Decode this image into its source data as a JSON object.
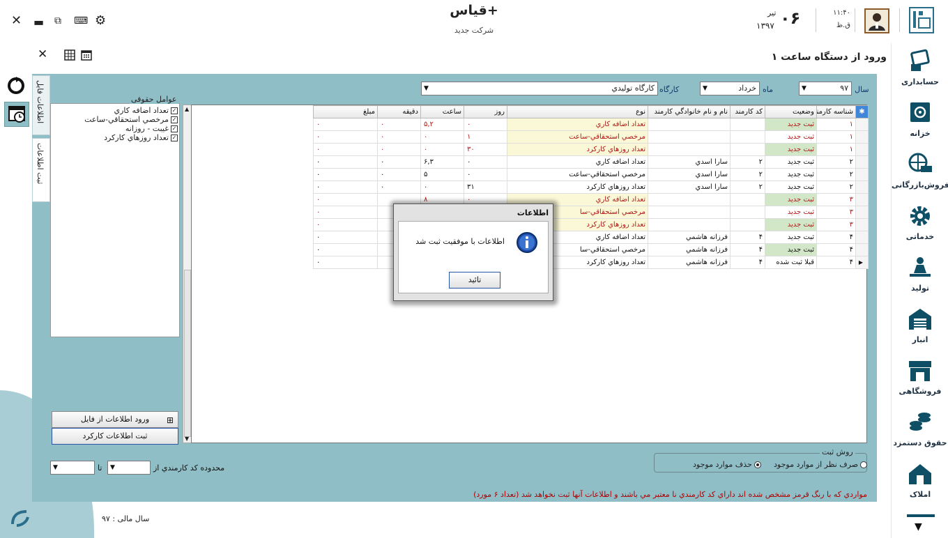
{
  "app": {
    "title": "قیاس+",
    "company": "شرکت جدید"
  },
  "clock": {
    "time": "۱۱:۴۰",
    "ampm": "ق.ظ",
    "day": "۰۶",
    "month": "تیر",
    "year": "۱۳۹۷"
  },
  "sidebar": {
    "items": [
      {
        "label": "حسابداری",
        "icon": "accounting-icon"
      },
      {
        "label": "خزانه",
        "icon": "safe-icon"
      },
      {
        "label": "فروش‌بازرگانی",
        "icon": "globe-truck-icon"
      },
      {
        "label": "خدماتی",
        "icon": "gear-icon"
      },
      {
        "label": "تولید",
        "icon": "worker-icon"
      },
      {
        "label": "انبار",
        "icon": "warehouse-icon"
      },
      {
        "label": "فروشگاهی",
        "icon": "store-icon"
      },
      {
        "label": "حقوق دستمزد",
        "icon": "coins-icon"
      },
      {
        "label": "املاک",
        "icon": "house-icon"
      }
    ]
  },
  "form": {
    "title": "ورود از دستگاه ساعت ۱"
  },
  "tabs": {
    "file": "اطلاعات فایل",
    "register": "ثبت اطلاعات"
  },
  "filters": {
    "year_label": "سال",
    "year_value": "۹۷",
    "month_label": "ماه",
    "month_value": "خرداد",
    "workshop_label": "کارگاه",
    "workshop_value": "كارگاه توليدي"
  },
  "factors": {
    "title": "عوامل حقوقی",
    "items": [
      "تعداد اضافه كاري",
      "مرخصي استحقاقي-ساعت",
      "غيبت - روزانه",
      "تعداد روزهاي كاركرد"
    ]
  },
  "buttons": {
    "import": "ورود اطلاعات از فایل",
    "save": "ثبت اطلاعات کارکرد"
  },
  "grid": {
    "columns": [
      "شناسه كارمند",
      "وضعيت",
      "كد كارمند",
      "نام و نام خانوادگي كارمند",
      "نوع",
      "روز",
      "ساعت",
      "دقيقه",
      "مبلغ"
    ],
    "rows": [
      {
        "id": "۱",
        "status": "ثبت جديد",
        "code": "",
        "name": "",
        "type": "تعداد اضافه كاري",
        "day": "۰",
        "hour": "۵,۲",
        "minute": "۰",
        "amount": "۰",
        "green": true,
        "red": true
      },
      {
        "id": "۱",
        "status": "ثبت جديد",
        "code": "",
        "name": "",
        "type": "مرخصي استحقاقي-ساعت",
        "day": "۱",
        "hour": "۰",
        "minute": "۰",
        "amount": "۰",
        "green": false,
        "red": true
      },
      {
        "id": "۱",
        "status": "ثبت جديد",
        "code": "",
        "name": "",
        "type": "تعداد روزهاي كاركرد",
        "day": "۳۰",
        "hour": "۰",
        "minute": "۰",
        "amount": "۰",
        "green": true,
        "red": true
      },
      {
        "id": "۲",
        "status": "ثبت جديد",
        "code": "۲",
        "name": "سارا اسدي",
        "type": "تعداد اضافه كاري",
        "day": "۰",
        "hour": "۶,۳",
        "minute": "۰",
        "amount": "۰",
        "green": false,
        "red": false
      },
      {
        "id": "۲",
        "status": "ثبت جديد",
        "code": "۲",
        "name": "سارا اسدي",
        "type": "مرخصي استحقاقي-ساعت",
        "day": "۰",
        "hour": "۵",
        "minute": "۰",
        "amount": "۰",
        "green": false,
        "red": false
      },
      {
        "id": "۲",
        "status": "ثبت جديد",
        "code": "۲",
        "name": "سارا اسدي",
        "type": "تعداد روزهاي كاركرد",
        "day": "۳۱",
        "hour": "۰",
        "minute": "۰",
        "amount": "۰",
        "green": false,
        "red": false
      },
      {
        "id": "۳",
        "status": "ثبت جديد",
        "code": "",
        "name": "",
        "type": "تعداد اضافه كاري",
        "day": "۰",
        "hour": "۸",
        "minute": "",
        "amount": "۰",
        "green": true,
        "red": true
      },
      {
        "id": "۳",
        "status": "ثبت جديد",
        "code": "",
        "name": "",
        "type": "مرخصي استحقاقي-سا",
        "day": "",
        "hour": "",
        "minute": "",
        "amount": "۰",
        "green": false,
        "red": true
      },
      {
        "id": "۳",
        "status": "ثبت جديد",
        "code": "",
        "name": "",
        "type": "تعداد روزهاي كاركرد",
        "day": "",
        "hour": "",
        "minute": "",
        "amount": "۰",
        "green": true,
        "red": true
      },
      {
        "id": "۴",
        "status": "ثبت جديد",
        "code": "۴",
        "name": "فرزانه هاشمي",
        "type": "تعداد اضافه كاري",
        "day": "",
        "hour": "",
        "minute": "",
        "amount": "۰",
        "green": false,
        "red": false
      },
      {
        "id": "۴",
        "status": "ثبت جديد",
        "code": "۴",
        "name": "فرزانه هاشمي",
        "type": "مرخصي استحقاقي-سا",
        "day": "",
        "hour": "",
        "minute": "",
        "amount": "۰",
        "green": true,
        "red": false
      },
      {
        "id": "۴",
        "status": "قبلا ثبت شده",
        "code": "۴",
        "name": "فرزانه هاشمي",
        "type": "تعداد روزهاي كاركرد",
        "day": "",
        "hour": "",
        "minute": "",
        "amount": "۰",
        "green": false,
        "red": false,
        "selected": true
      }
    ]
  },
  "method": {
    "title": "روش ثبت",
    "option_ignore": "صرف نظر از موارد موجود",
    "option_delete": "حذف موارد موجود",
    "selected": "delete"
  },
  "range": {
    "label": "محدوده كد كارمندي از",
    "to": "تا"
  },
  "warning": "مواردي که با رنگ قرمز مشخص شده اند داراي کد کارمندي نا معتبر مي باشند و اطلاعات آنها ثبت نخواهد شد (تعداد ۶ مورد)",
  "footer": {
    "fiscal_year": "سال مالی : ۹۷"
  },
  "dialog": {
    "title": "اطلاعات",
    "message": "اطلاعات با موفقيت ثبت شد",
    "ok": "تائيد"
  },
  "colors": {
    "panel": "#8fbec7",
    "accent": "#2a6e8c",
    "invalid_text": "#b01818",
    "status_green": "#d2e7c8",
    "type_yellow": "#fbf8d7"
  }
}
